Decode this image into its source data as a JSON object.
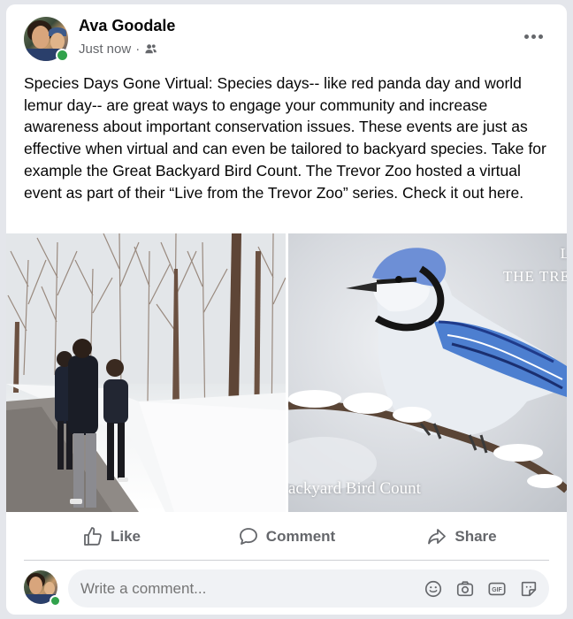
{
  "post": {
    "author": "Ava Goodale",
    "timestamp": "Just now",
    "audience_icon": "friends-icon",
    "text": "Species Days Gone Virtual: Species days--  like red panda day and world lemur day-- are great ways to engage your community and increase awareness about important conservation issues. These events are just as effective when virtual and can even be tailored to backyard species. Take for example the Great Backyard Bird Count. The Trevor Zoo hosted a virtual event as part of their “Live from the Trevor Zoo” series. Check it out here."
  },
  "media": {
    "right_caption_top_line1": "L",
    "right_caption_top_line2": "THE TRE",
    "right_caption_bottom": "ackyard Bird Count"
  },
  "actions": {
    "like": "Like",
    "comment": "Comment",
    "share": "Share"
  },
  "comment_bar": {
    "placeholder": "Write a comment..."
  },
  "colors": {
    "secondary_text": "#65676b",
    "online_green": "#31a24c",
    "comment_bg": "#f0f2f5"
  }
}
